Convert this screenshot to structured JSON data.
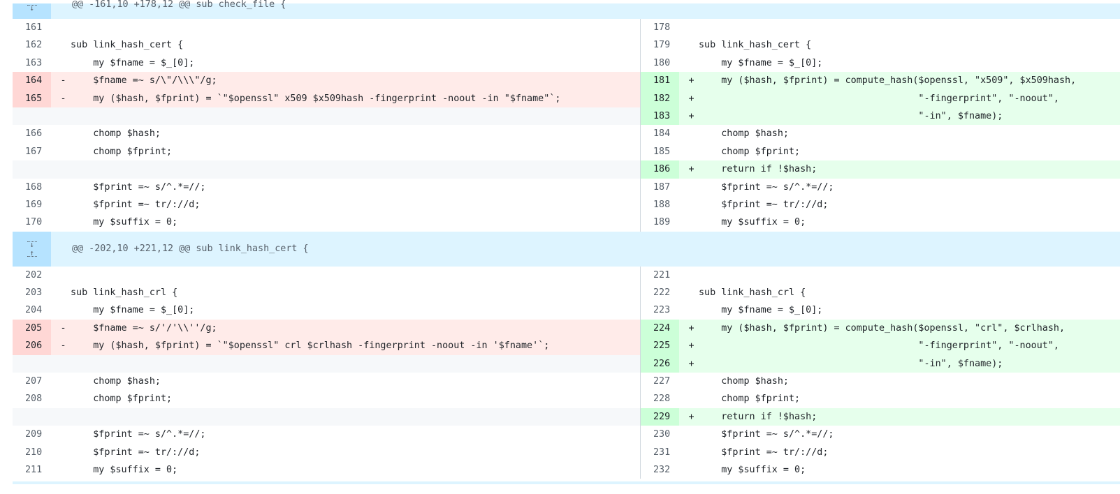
{
  "hunks": [
    {
      "header": "@@ -161,10 +178,12 @@ sub check_file {",
      "rows": [
        {
          "l_num": "161",
          "l_mark": "",
          "l_code": "",
          "l_type": "ctx",
          "r_num": "178",
          "r_mark": "",
          "r_code": "",
          "r_type": "ctx"
        },
        {
          "l_num": "162",
          "l_mark": "",
          "l_code": "sub link_hash_cert {",
          "l_type": "ctx",
          "r_num": "179",
          "r_mark": "",
          "r_code": "sub link_hash_cert {",
          "r_type": "ctx"
        },
        {
          "l_num": "163",
          "l_mark": "",
          "l_code": "    my $fname = $_[0];",
          "l_type": "ctx",
          "r_num": "180",
          "r_mark": "",
          "r_code": "    my $fname = $_[0];",
          "r_type": "ctx"
        },
        {
          "l_num": "164",
          "l_mark": "-",
          "l_code": "    $fname =~ s/\\\"/\\\\\\\"/g;",
          "l_type": "del",
          "r_num": "181",
          "r_mark": "+",
          "r_code": "    my ($hash, $fprint) = compute_hash($openssl, \"x509\", $x509hash,",
          "r_type": "add"
        },
        {
          "l_num": "165",
          "l_mark": "-",
          "l_code": "    my ($hash, $fprint) = `\"$openssl\" x509 $x509hash -fingerprint -noout -in \"$fname\"`;",
          "l_type": "del",
          "r_num": "182",
          "r_mark": "+",
          "r_code": "                                       \"-fingerprint\", \"-noout\",",
          "r_type": "add"
        },
        {
          "l_num": "",
          "l_mark": "",
          "l_code": "",
          "l_type": "empty",
          "r_num": "183",
          "r_mark": "+",
          "r_code": "                                       \"-in\", $fname);",
          "r_type": "add"
        },
        {
          "l_num": "166",
          "l_mark": "",
          "l_code": "    chomp $hash;",
          "l_type": "ctx",
          "r_num": "184",
          "r_mark": "",
          "r_code": "    chomp $hash;",
          "r_type": "ctx"
        },
        {
          "l_num": "167",
          "l_mark": "",
          "l_code": "    chomp $fprint;",
          "l_type": "ctx",
          "r_num": "185",
          "r_mark": "",
          "r_code": "    chomp $fprint;",
          "r_type": "ctx"
        },
        {
          "l_num": "",
          "l_mark": "",
          "l_code": "",
          "l_type": "empty",
          "r_num": "186",
          "r_mark": "+",
          "r_code": "    return if !$hash;",
          "r_type": "add"
        },
        {
          "l_num": "168",
          "l_mark": "",
          "l_code": "    $fprint =~ s/^.*=//;",
          "l_type": "ctx",
          "r_num": "187",
          "r_mark": "",
          "r_code": "    $fprint =~ s/^.*=//;",
          "r_type": "ctx"
        },
        {
          "l_num": "169",
          "l_mark": "",
          "l_code": "    $fprint =~ tr/://d;",
          "l_type": "ctx",
          "r_num": "188",
          "r_mark": "",
          "r_code": "    $fprint =~ tr/://d;",
          "r_type": "ctx"
        },
        {
          "l_num": "170",
          "l_mark": "",
          "l_code": "    my $suffix = 0;",
          "l_type": "ctx",
          "r_num": "189",
          "r_mark": "",
          "r_code": "    my $suffix = 0;",
          "r_type": "ctx"
        }
      ]
    },
    {
      "header": "@@ -202,10 +221,12 @@ sub link_hash_cert {",
      "rows": [
        {
          "l_num": "202",
          "l_mark": "",
          "l_code": "",
          "l_type": "ctx",
          "r_num": "221",
          "r_mark": "",
          "r_code": "",
          "r_type": "ctx"
        },
        {
          "l_num": "203",
          "l_mark": "",
          "l_code": "sub link_hash_crl {",
          "l_type": "ctx",
          "r_num": "222",
          "r_mark": "",
          "r_code": "sub link_hash_crl {",
          "r_type": "ctx"
        },
        {
          "l_num": "204",
          "l_mark": "",
          "l_code": "    my $fname = $_[0];",
          "l_type": "ctx",
          "r_num": "223",
          "r_mark": "",
          "r_code": "    my $fname = $_[0];",
          "r_type": "ctx"
        },
        {
          "l_num": "205",
          "l_mark": "-",
          "l_code": "    $fname =~ s/'/'\\\\''/g;",
          "l_type": "del",
          "r_num": "224",
          "r_mark": "+",
          "r_code": "    my ($hash, $fprint) = compute_hash($openssl, \"crl\", $crlhash,",
          "r_type": "add"
        },
        {
          "l_num": "206",
          "l_mark": "-",
          "l_code": "    my ($hash, $fprint) = `\"$openssl\" crl $crlhash -fingerprint -noout -in '$fname'`;",
          "l_type": "del",
          "r_num": "225",
          "r_mark": "+",
          "r_code": "                                       \"-fingerprint\", \"-noout\",",
          "r_type": "add"
        },
        {
          "l_num": "",
          "l_mark": "",
          "l_code": "",
          "l_type": "empty",
          "r_num": "226",
          "r_mark": "+",
          "r_code": "                                       \"-in\", $fname);",
          "r_type": "add"
        },
        {
          "l_num": "207",
          "l_mark": "",
          "l_code": "    chomp $hash;",
          "l_type": "ctx",
          "r_num": "227",
          "r_mark": "",
          "r_code": "    chomp $hash;",
          "r_type": "ctx"
        },
        {
          "l_num": "208",
          "l_mark": "",
          "l_code": "    chomp $fprint;",
          "l_type": "ctx",
          "r_num": "228",
          "r_mark": "",
          "r_code": "    chomp $fprint;",
          "r_type": "ctx"
        },
        {
          "l_num": "",
          "l_mark": "",
          "l_code": "",
          "l_type": "empty",
          "r_num": "229",
          "r_mark": "+",
          "r_code": "    return if !$hash;",
          "r_type": "add"
        },
        {
          "l_num": "209",
          "l_mark": "",
          "l_code": "    $fprint =~ s/^.*=//;",
          "l_type": "ctx",
          "r_num": "230",
          "r_mark": "",
          "r_code": "    $fprint =~ s/^.*=//;",
          "r_type": "ctx"
        },
        {
          "l_num": "210",
          "l_mark": "",
          "l_code": "    $fprint =~ tr/://d;",
          "l_type": "ctx",
          "r_num": "231",
          "r_mark": "",
          "r_code": "    $fprint =~ tr/://d;",
          "r_type": "ctx"
        },
        {
          "l_num": "211",
          "l_mark": "",
          "l_code": "    my $suffix = 0;",
          "l_type": "ctx",
          "r_num": "232",
          "r_mark": "",
          "r_code": "    my $suffix = 0;",
          "r_type": "ctx"
        }
      ]
    }
  ],
  "icons": {
    "expand_down": "expand-down-icon",
    "expand_up": "expand-up-icon"
  },
  "colors": {
    "deletion_bg": "#ffebe9",
    "addition_bg": "#e6ffec",
    "hunk_bg": "#ddf4ff"
  }
}
